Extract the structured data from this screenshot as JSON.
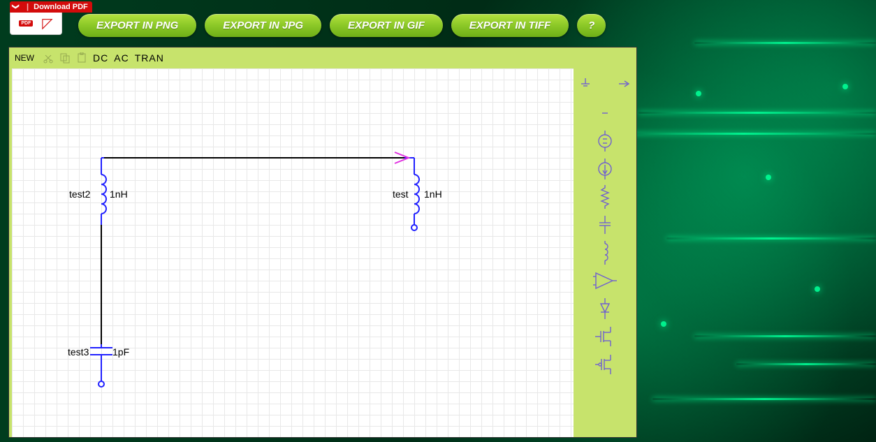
{
  "pdf_widget": {
    "download_label": "Download PDF",
    "badge": "PDF"
  },
  "buttons": {
    "export_png": "EXPORT IN PNG",
    "export_jpg": "EXPORT IN JPG",
    "export_gif": "EXPORT IN GIF",
    "export_tiff": "EXPORT IN TIFF",
    "help": "?"
  },
  "toolbar": {
    "new_label": "NEW",
    "sim": {
      "dc": "DC",
      "ac": "AC",
      "tran": "TRAN"
    }
  },
  "components": {
    "ind_left": {
      "name": "test2",
      "value": "1nH"
    },
    "ind_right": {
      "name": "test",
      "value": "1nH"
    },
    "cap": {
      "name": "test3",
      "value": "1pF"
    }
  },
  "palette": {
    "items": [
      "ground-icon",
      "port-icon",
      "label-icon",
      "vsource-icon",
      "isource-icon",
      "resistor-icon",
      "capacitor-icon",
      "inductor-icon",
      "opamp-icon",
      "diode-icon",
      "nfet-icon",
      "pfet-icon"
    ]
  }
}
